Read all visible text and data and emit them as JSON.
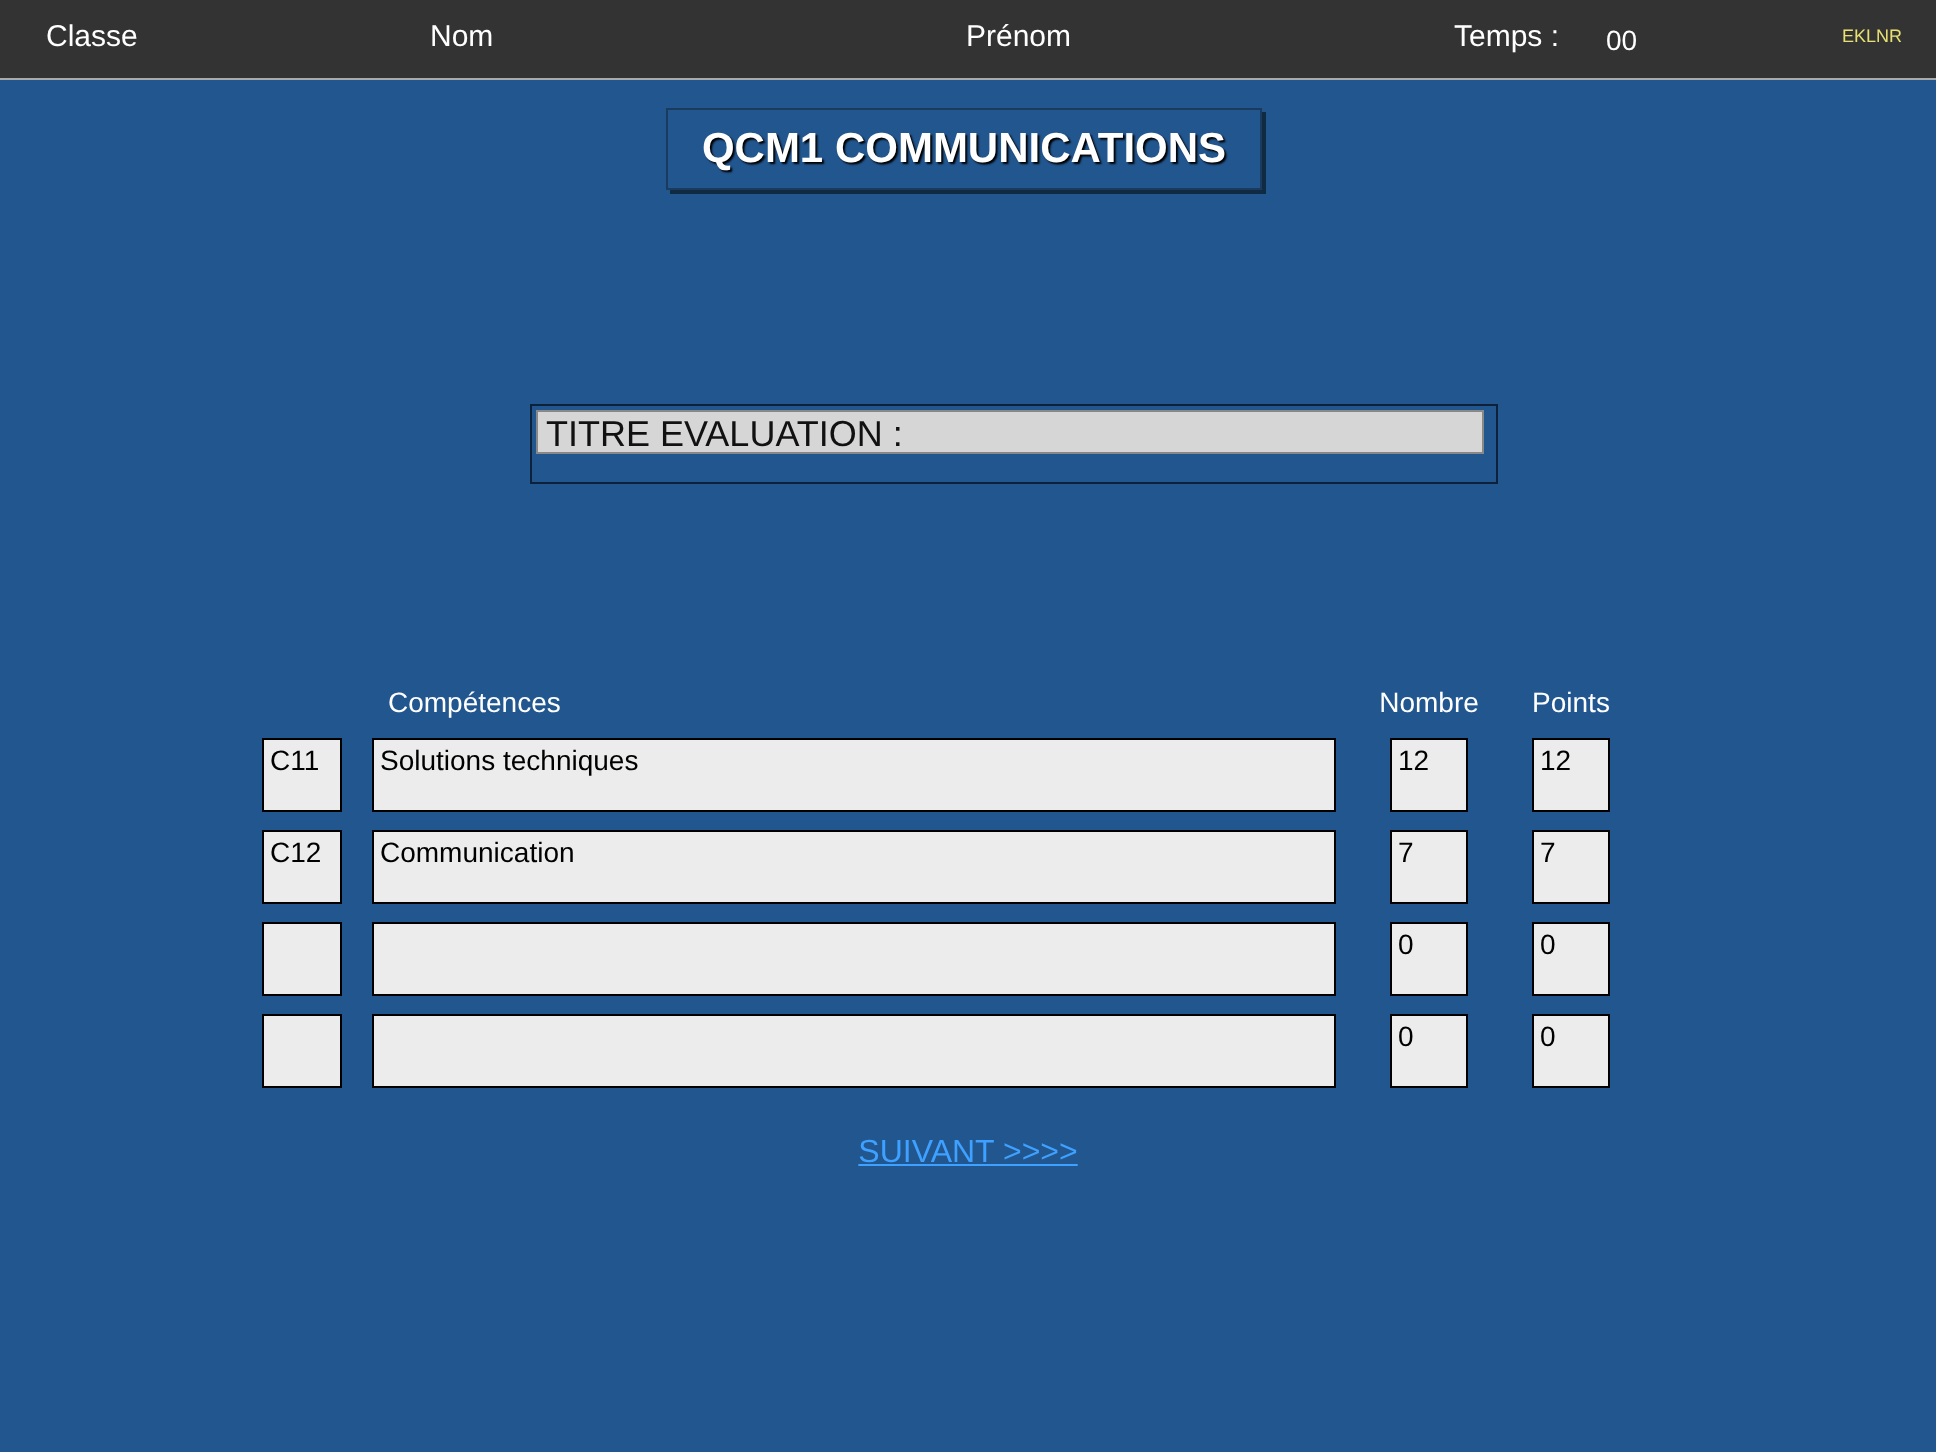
{
  "header": {
    "fields": [
      "Classe",
      "Nom",
      "Prénom",
      "Temps :"
    ],
    "timer": "00",
    "badge": "EKLNR"
  },
  "title": "QCM1 COMMUNICATIONS",
  "evaluation": {
    "value": "TITRE EVALUATION :"
  },
  "table": {
    "columns": [
      "Compétences",
      "Nombre",
      "Points"
    ],
    "rows": [
      {
        "code": "C11",
        "label": "Solutions techniques",
        "nombre": "12",
        "points": "12"
      },
      {
        "code": "C12",
        "label": "Communication",
        "nombre": "7",
        "points": "7"
      },
      {
        "nombre": "0",
        "points": "0"
      },
      {
        "nombre": "0",
        "points": "0"
      }
    ]
  },
  "next_link": "SUIVANT >>>>"
}
